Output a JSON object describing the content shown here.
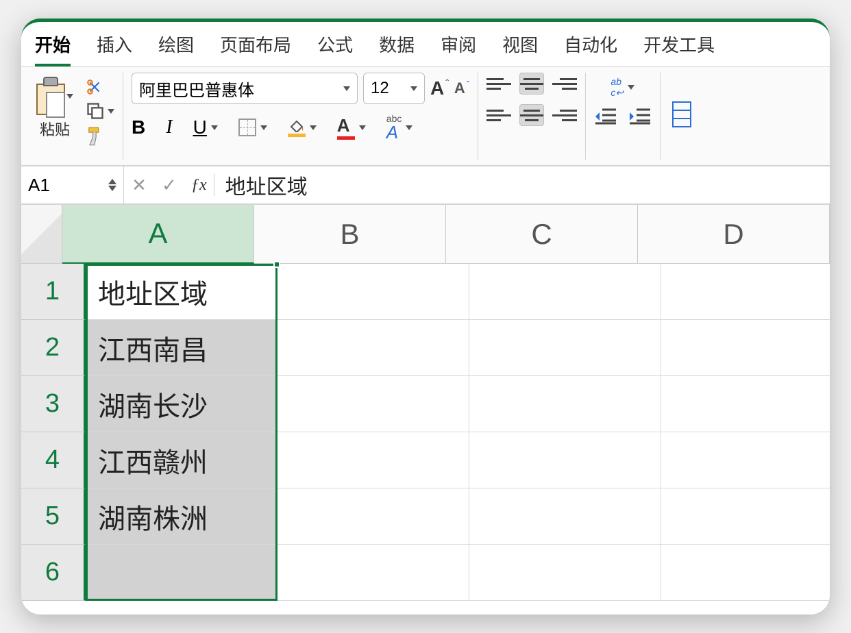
{
  "ribbon_tabs": {
    "home": "开始",
    "insert": "插入",
    "draw": "绘图",
    "layout": "页面布局",
    "formulas": "公式",
    "data": "数据",
    "review": "审阅",
    "view": "视图",
    "automation": "自动化",
    "developer": "开发工具"
  },
  "toolbar": {
    "paste_label": "粘贴",
    "font_name": "阿里巴巴普惠体",
    "font_size": "12"
  },
  "formula_bar": {
    "cell_ref": "A1",
    "value": "地址区域"
  },
  "columns": [
    "A",
    "B",
    "C",
    "D"
  ],
  "rows": {
    "1": {
      "A": "地址区域"
    },
    "2": {
      "A": "江西南昌"
    },
    "3": {
      "A": "湖南长沙"
    },
    "4": {
      "A": "江西赣州"
    },
    "5": {
      "A": "湖南株洲"
    },
    "6": {
      "A": ""
    }
  },
  "colors": {
    "accent": "#0f7a3e",
    "font_color": "#e62323",
    "fill_color": "#f7b733"
  }
}
